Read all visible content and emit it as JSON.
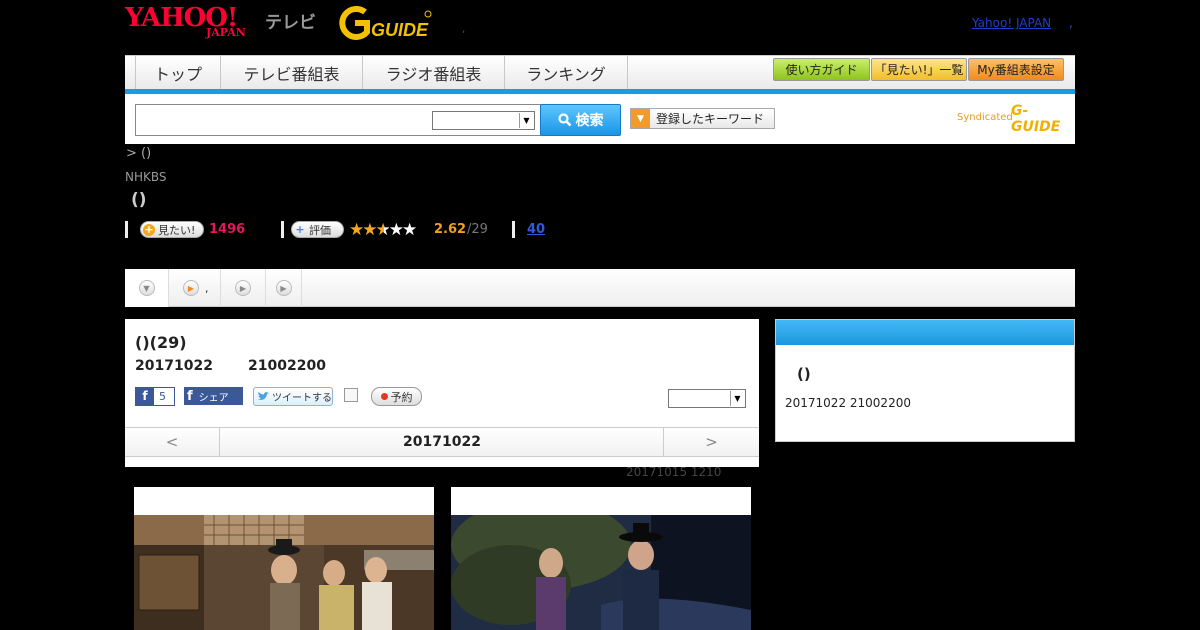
{
  "header": {
    "yahoo_logo": "YAHOO!",
    "japan_logo": "JAPAN",
    "tv_label": "テレビ",
    "gguide_logo": "G-GUIDE",
    "separator": ",",
    "yahoo_japan_link": "Yahoo! JAPAN",
    "trailing_comma": ","
  },
  "nav": {
    "tabs": [
      "トップ",
      "テレビ番組表",
      "ラジオ番組表",
      "ランキング"
    ],
    "buttons": [
      "使い方ガイド",
      "「見たい!」一覧",
      "My番組表設定"
    ],
    "button_colors": [
      "#9acd32",
      "#f5c542",
      "#f39a2b"
    ]
  },
  "search": {
    "input_value": "",
    "select_value": "",
    "button_label": "検索",
    "keyword_button": "登録したキーワード",
    "syndicated": "Syndicated",
    "gguide_mark": "G-GUIDE"
  },
  "program": {
    "breadcrumb": ">  ()",
    "channel": "NHKBS",
    "title": "()",
    "mitai_label": "見たい!",
    "mitai_count": "1496",
    "rate_label": "評価",
    "rating_stars": 2.62,
    "rating": "2.62",
    "rating_total": "/29",
    "review_count": "40"
  },
  "tabs": {
    "tab2_text": ","
  },
  "episode": {
    "title": "()(29)",
    "date": "20171022",
    "time": "21002200",
    "fb_count": "5",
    "fb_share": "シェア",
    "tweet": "ツイートする",
    "reserve": "予約",
    "select_value": "",
    "nav_prev": "<",
    "nav_date": "20171022",
    "nav_next": ">",
    "updated": "20171015  1210"
  },
  "side": {
    "title": "()",
    "info": "20171022  21002200"
  },
  "colors": {
    "accent_blue": "#1c9be0",
    "mitai_pink": "#e0185c",
    "rating_orange": "#f0a020",
    "link_blue": "#2f5bdc"
  }
}
